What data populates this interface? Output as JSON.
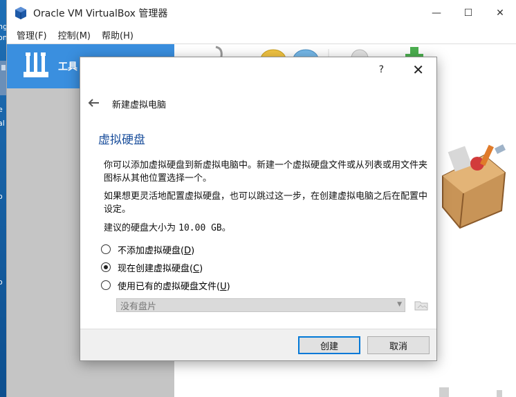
{
  "window": {
    "title": "Oracle VM VirtualBox 管理器",
    "controls": {
      "minimize": "—",
      "maximize": "☐",
      "close": "✕"
    }
  },
  "menubar": {
    "items": [
      "管理(F)",
      "控制(M)",
      "帮助(H)"
    ]
  },
  "sidebar": {
    "tools_label": "工具"
  },
  "desktop_fragments": [
    "ng",
    "on",
    "e",
    "al",
    "o",
    "o"
  ],
  "dialog": {
    "help": "?",
    "close": "✕",
    "back_icon": "🡐",
    "wizard_title": "新建虚拟电脑",
    "heading": "虚拟硬盘",
    "paragraph1": "你可以添加虚拟硬盘到新虚拟电脑中。新建一个虚拟硬盘文件或从列表或用文件夹图标从其他位置选择一个。",
    "paragraph2": "如果想更灵活地配置虚拟硬盘，也可以跳过这一步，在创建虚拟电脑之后在配置中设定。",
    "size_prefix": "建议的硬盘大小为 ",
    "size_value": "10.00 GB",
    "size_suffix": "。",
    "options": [
      {
        "label": "不添加虚拟硬盘",
        "key": "D",
        "checked": false
      },
      {
        "label": "现在创建虚拟硬盘",
        "key": "C",
        "checked": true
      },
      {
        "label": "使用已有的虚拟硬盘文件",
        "key": "U",
        "checked": false
      }
    ],
    "disk_select_value": "没有盘片",
    "create_button": "创建",
    "cancel_button": "取消"
  }
}
